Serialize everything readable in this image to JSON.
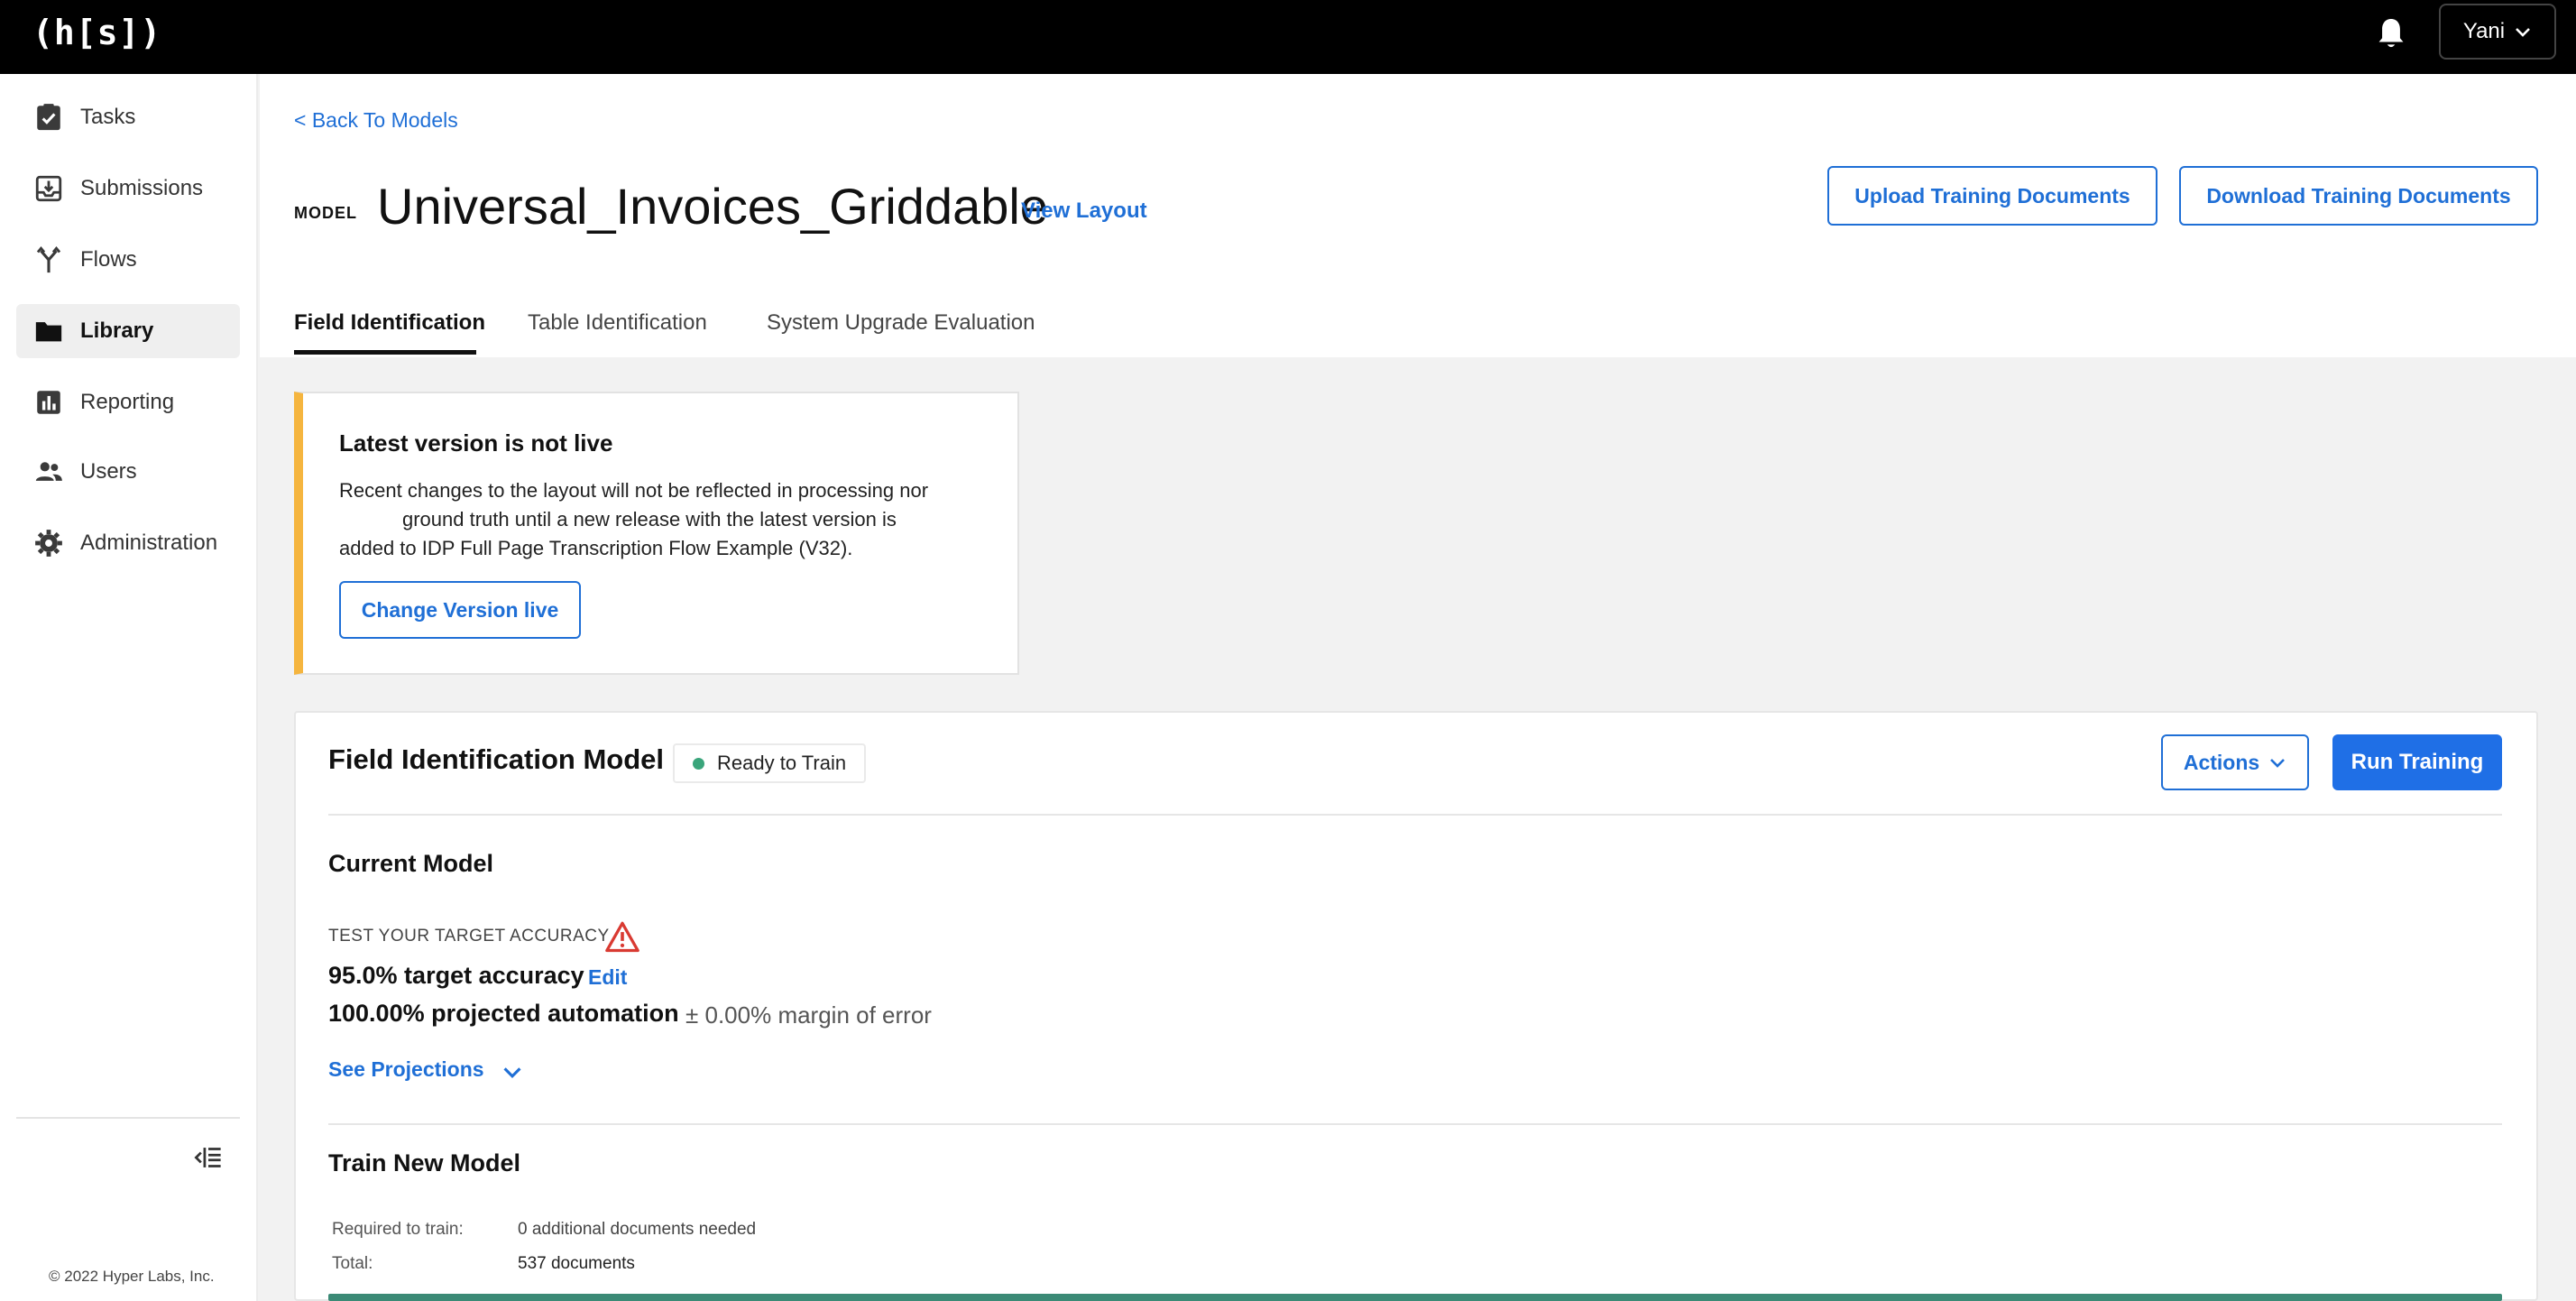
{
  "app": {
    "logo": "(h[s])"
  },
  "user": {
    "name": "Yani"
  },
  "sidebar": {
    "items": [
      {
        "label": "Tasks",
        "icon": "clipboard-check-icon"
      },
      {
        "label": "Submissions",
        "icon": "inbox-download-icon"
      },
      {
        "label": "Flows",
        "icon": "flow-branch-icon"
      },
      {
        "label": "Library",
        "icon": "folder-icon",
        "active": true
      },
      {
        "label": "Reporting",
        "icon": "bar-chart-icon"
      },
      {
        "label": "Users",
        "icon": "users-icon"
      },
      {
        "label": "Administration",
        "icon": "gear-icon"
      }
    ],
    "copyright": "© 2022 Hyper Labs, Inc."
  },
  "header": {
    "back_link": "< Back To Models",
    "model_tag": "MODEL",
    "model_name": "Universal_Invoices_Griddable",
    "view_layout": "View Layout",
    "upload_label": "Upload Training Documents",
    "download_label": "Download Training Documents"
  },
  "tabs": [
    {
      "label": "Field Identification",
      "active": true
    },
    {
      "label": "Table Identification"
    },
    {
      "label": "System Upgrade Evaluation"
    }
  ],
  "warning": {
    "title": "Latest version is not live",
    "body_line1": "Recent changes to the layout will not be reflected in processing nor",
    "body_line2": "ground truth until a new release with the latest version is",
    "body_line3": "added to IDP Full Page Transcription Flow Example (V32).",
    "button": "Change Version live",
    "accent_color": "#f5b53f"
  },
  "model_card": {
    "title": "Field Identification Model",
    "status": "Ready to Train",
    "status_color": "#3aa57b",
    "actions_label": "Actions",
    "run_label": "Run Training",
    "current": {
      "title": "Current Model",
      "test_label": "TEST YOUR TARGET ACCURACY",
      "target_accuracy": "95.0% target accuracy",
      "edit_label": "Edit",
      "projected_automation": "100.00% projected automation",
      "margin_of_error": "± 0.00% margin of error",
      "see_projections": "See Projections"
    },
    "train_new": {
      "title": "Train New Model",
      "required_label": "Required to train:",
      "required_value": "0 additional documents needed",
      "total_label": "Total:",
      "total_value": "537 documents",
      "progress_fraction": 1.0
    }
  },
  "colors": {
    "accent": "#1f6fd6",
    "primary_button": "#1f6fe6",
    "topbar": "#000000"
  }
}
